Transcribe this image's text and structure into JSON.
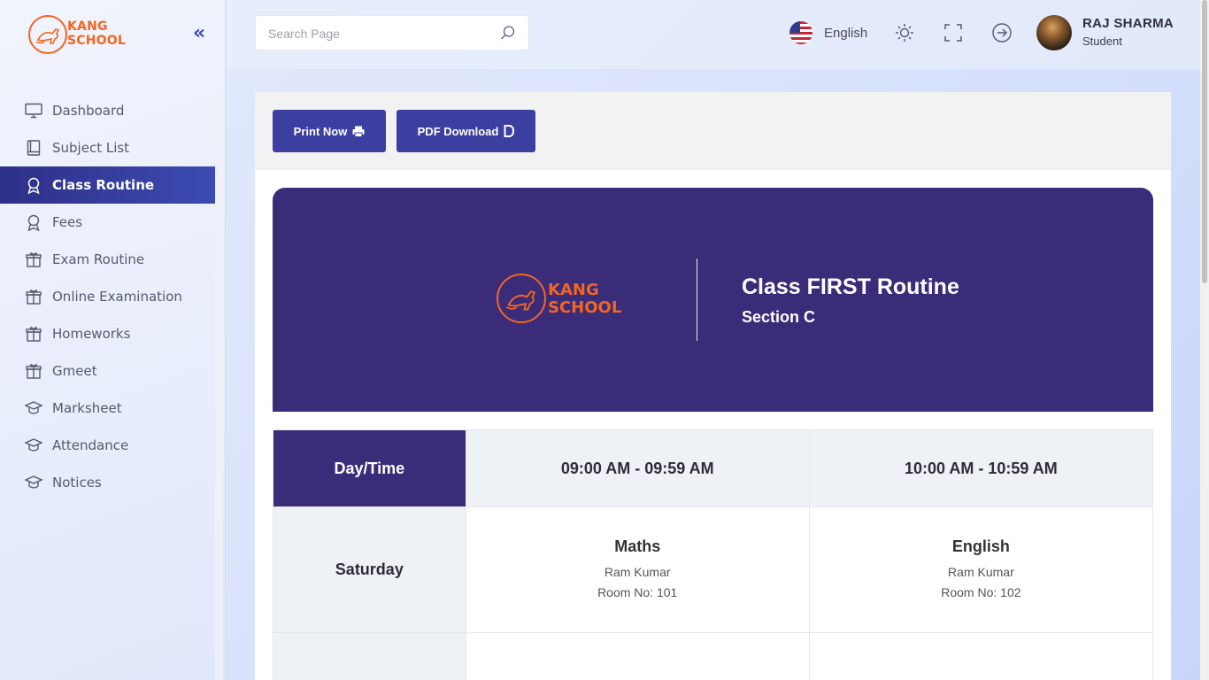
{
  "brand": {
    "line1": "KANG",
    "line2": "SCHOOL"
  },
  "sidebar": {
    "items": [
      {
        "label": "Dashboard",
        "icon": "monitor-icon",
        "active": false
      },
      {
        "label": "Subject List",
        "icon": "book-icon",
        "active": false
      },
      {
        "label": "Class Routine",
        "icon": "award-icon",
        "active": true
      },
      {
        "label": "Fees",
        "icon": "award-icon",
        "active": false
      },
      {
        "label": "Exam Routine",
        "icon": "gift-icon",
        "active": false
      },
      {
        "label": "Online Examination",
        "icon": "gift-icon",
        "active": false
      },
      {
        "label": "Homeworks",
        "icon": "gift-icon",
        "active": false
      },
      {
        "label": "Gmeet",
        "icon": "gift-icon",
        "active": false
      },
      {
        "label": "Marksheet",
        "icon": "graduation-cap-icon",
        "active": false
      },
      {
        "label": "Attendance",
        "icon": "graduation-cap-icon",
        "active": false
      },
      {
        "label": "Notices",
        "icon": "graduation-cap-icon",
        "active": false
      }
    ]
  },
  "header": {
    "search_placeholder": "Search Page",
    "language": "English",
    "user": {
      "name": "RAJ SHARMA",
      "role": "Student"
    }
  },
  "toolbar": {
    "print_label": "Print Now",
    "pdf_label": "PDF Download"
  },
  "banner": {
    "title": "Class FIRST Routine",
    "section": "Section C"
  },
  "routine": {
    "header_label": "Day/Time",
    "slots": [
      "09:00 AM - 09:59 AM",
      "10:00 AM - 10:59 AM"
    ],
    "rows": [
      {
        "day": "Saturday",
        "cells": [
          {
            "subject": "Maths",
            "teacher": "Ram Kumar",
            "room": "Room No: 101"
          },
          {
            "subject": "English",
            "teacher": "Ram Kumar",
            "room": "Room No: 102"
          }
        ]
      }
    ]
  },
  "colors": {
    "primary": "#3b2c7a",
    "accent": "#f26522",
    "button": "#3d3fa0"
  }
}
